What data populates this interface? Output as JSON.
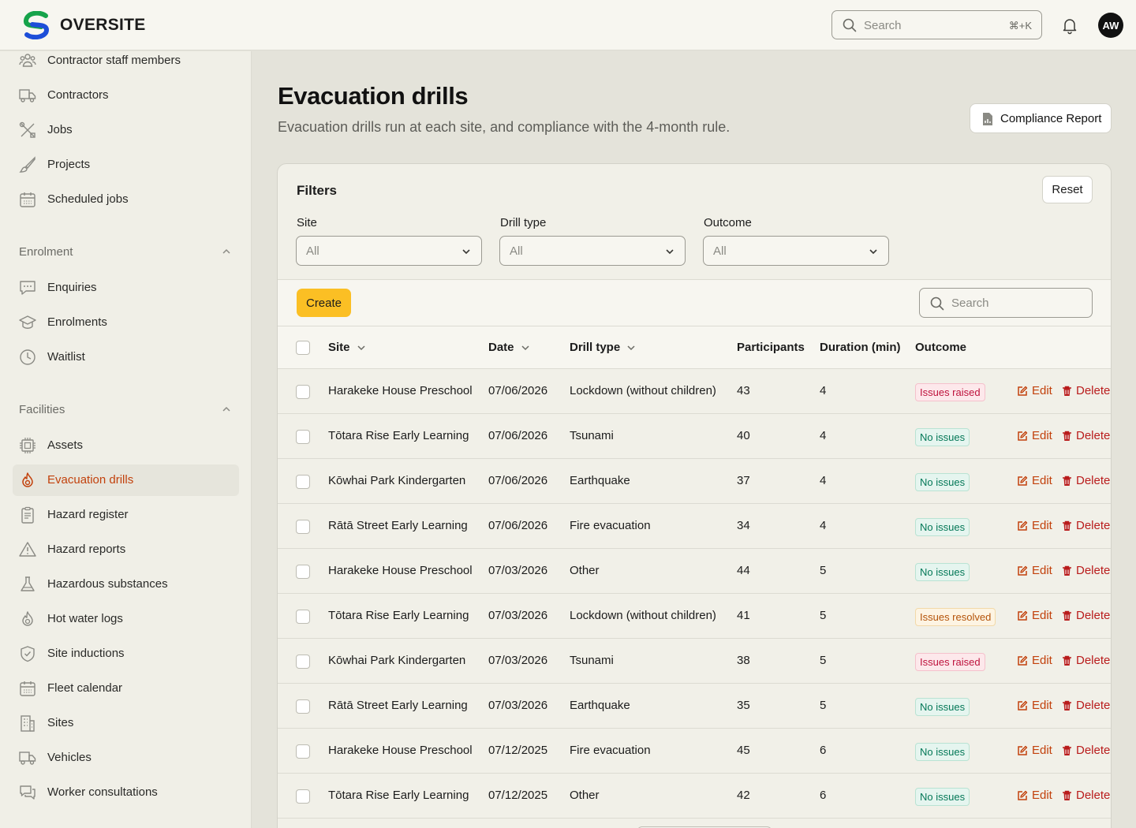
{
  "header": {
    "brand": "OVERSITE",
    "search_placeholder": "Search",
    "search_shortcut": "⌘+K",
    "avatar_initials": "AW"
  },
  "sidebar": {
    "top_items": [
      {
        "label": "Contractor staff members",
        "icon": "users-icon"
      },
      {
        "label": "Contractors",
        "icon": "truck-icon"
      },
      {
        "label": "Jobs",
        "icon": "tools-icon"
      },
      {
        "label": "Projects",
        "icon": "brush-icon"
      },
      {
        "label": "Scheduled jobs",
        "icon": "calendar-icon"
      }
    ],
    "enrolment": {
      "title": "Enrolment",
      "items": [
        {
          "label": "Enquiries",
          "icon": "chat-icon"
        },
        {
          "label": "Enrolments",
          "icon": "graduation-cap-icon"
        },
        {
          "label": "Waitlist",
          "icon": "clock-icon"
        }
      ]
    },
    "facilities": {
      "title": "Facilities",
      "items": [
        {
          "label": "Assets",
          "icon": "chip-icon"
        },
        {
          "label": "Evacuation drills",
          "icon": "fire-icon",
          "active": true
        },
        {
          "label": "Hazard register",
          "icon": "clipboard-icon"
        },
        {
          "label": "Hazard reports",
          "icon": "warning-icon"
        },
        {
          "label": "Hazardous substances",
          "icon": "flask-icon"
        },
        {
          "label": "Hot water logs",
          "icon": "flame-icon"
        },
        {
          "label": "Site inductions",
          "icon": "shield-check-icon"
        },
        {
          "label": "Fleet calendar",
          "icon": "calendar-icon"
        },
        {
          "label": "Sites",
          "icon": "building-icon"
        },
        {
          "label": "Vehicles",
          "icon": "truck-icon"
        },
        {
          "label": "Worker consultations",
          "icon": "chat-bubbles-icon"
        }
      ]
    }
  },
  "page": {
    "title": "Evacuation drills",
    "subtitle": "Evacuation drills run at each site, and compliance with the 4-month rule.",
    "report_button": "Compliance Report"
  },
  "filters": {
    "title": "Filters",
    "reset_label": "Reset",
    "site": {
      "label": "Site",
      "value": "All"
    },
    "drill_type": {
      "label": "Drill type",
      "value": "All"
    },
    "outcome": {
      "label": "Outcome",
      "value": "All"
    }
  },
  "toolbar": {
    "create_label": "Create",
    "search_placeholder": "Search"
  },
  "table": {
    "columns": {
      "site": "Site",
      "date": "Date",
      "drill_type": "Drill type",
      "participants": "Participants",
      "duration": "Duration (min)",
      "outcome": "Outcome"
    },
    "edit_label": "Edit",
    "delete_label": "Delete",
    "rows": [
      {
        "site": "Harakeke House Preschool",
        "date": "07/06/2026",
        "drill_type": "Lockdown (without children)",
        "participants": "43",
        "duration": "4",
        "outcome": "Issues raised",
        "status": "raised"
      },
      {
        "site": "Tōtara Rise Early Learning",
        "date": "07/06/2026",
        "drill_type": "Tsunami",
        "participants": "40",
        "duration": "4",
        "outcome": "No issues",
        "status": "none"
      },
      {
        "site": "Kōwhai Park Kindergarten",
        "date": "07/06/2026",
        "drill_type": "Earthquake",
        "participants": "37",
        "duration": "4",
        "outcome": "No issues",
        "status": "none"
      },
      {
        "site": "Rātā Street Early Learning",
        "date": "07/06/2026",
        "drill_type": "Fire evacuation",
        "participants": "34",
        "duration": "4",
        "outcome": "No issues",
        "status": "none"
      },
      {
        "site": "Harakeke House Preschool",
        "date": "07/03/2026",
        "drill_type": "Other",
        "participants": "44",
        "duration": "5",
        "outcome": "No issues",
        "status": "none"
      },
      {
        "site": "Tōtara Rise Early Learning",
        "date": "07/03/2026",
        "drill_type": "Lockdown (without children)",
        "participants": "41",
        "duration": "5",
        "outcome": "Issues resolved",
        "status": "resolved"
      },
      {
        "site": "Kōwhai Park Kindergarten",
        "date": "07/03/2026",
        "drill_type": "Tsunami",
        "participants": "38",
        "duration": "5",
        "outcome": "Issues raised",
        "status": "raised"
      },
      {
        "site": "Rātā Street Early Learning",
        "date": "07/03/2026",
        "drill_type": "Earthquake",
        "participants": "35",
        "duration": "5",
        "outcome": "No issues",
        "status": "none"
      },
      {
        "site": "Harakeke House Preschool",
        "date": "07/12/2025",
        "drill_type": "Fire evacuation",
        "participants": "45",
        "duration": "6",
        "outcome": "No issues",
        "status": "none"
      },
      {
        "site": "Tōtara Rise Early Learning",
        "date": "07/12/2025",
        "drill_type": "Other",
        "participants": "42",
        "duration": "6",
        "outcome": "No issues",
        "status": "none"
      }
    ]
  },
  "colors": {
    "accent": "#c2410c",
    "create_button": "#fbbf24",
    "delete": "#b91c1c"
  }
}
